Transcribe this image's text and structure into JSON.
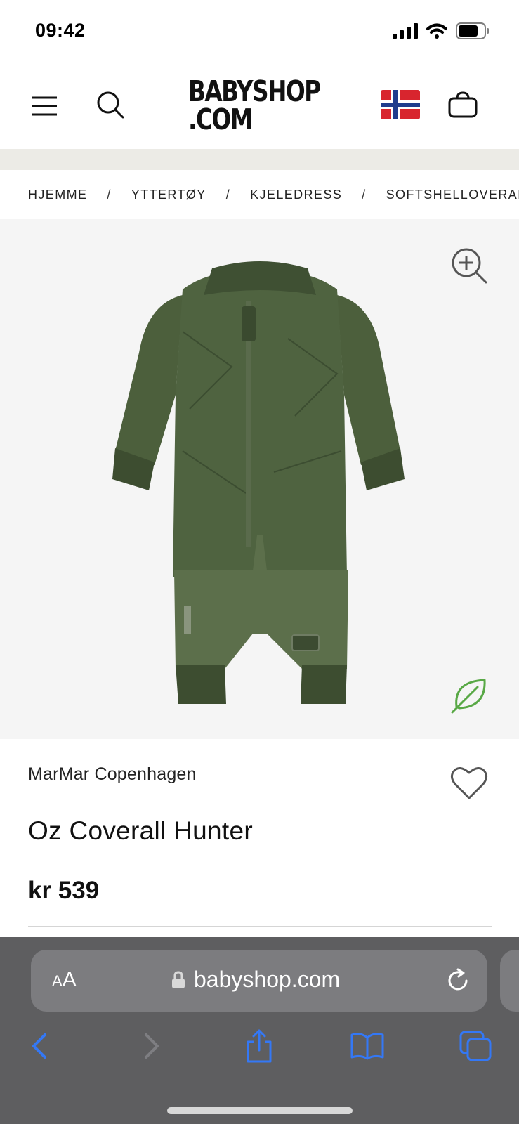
{
  "status_bar": {
    "time": "09:42"
  },
  "header": {
    "logo_line1": "BABYSHOP",
    "logo_line2": ".COM"
  },
  "breadcrumb": {
    "items": [
      "HJEMME",
      "YTTERTØY",
      "KJELEDRESS",
      "SOFTSHELLOVERALLER"
    ],
    "separator": "/"
  },
  "product": {
    "brand": "MarMar Copenhagen",
    "title": "Oz Coverall Hunter",
    "price": "kr 539",
    "image_icon": "green-coverall-image"
  },
  "browser": {
    "text_size_label_small": "A",
    "text_size_label_large": "A",
    "url": "babyshop.com"
  },
  "colors": {
    "accent_blue": "#3478f6",
    "leaf_green": "#58a845",
    "coverall_green": "#4a5e3b",
    "browser_bar": "#5e5e60"
  }
}
